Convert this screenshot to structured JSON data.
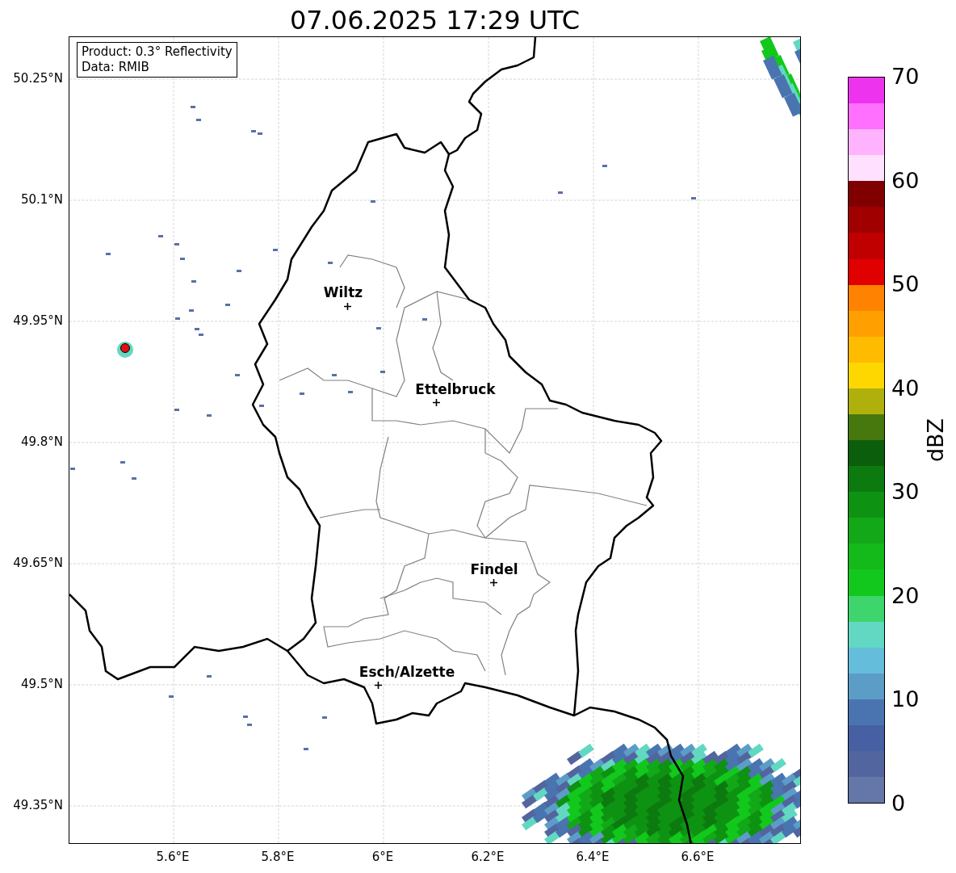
{
  "title": "07.06.2025 17:29 UTC",
  "map": {
    "legend": [
      "Product: 0.3° Reflectivity",
      "Data: RMIB"
    ],
    "lat_ticks": [
      "50.25°N",
      "50.1°N",
      "49.95°N",
      "49.8°N",
      "49.65°N",
      "49.5°N",
      "49.35°N"
    ],
    "lon_ticks": [
      "5.6°E",
      "5.8°E",
      "6°E",
      "6.2°E",
      "6.4°E",
      "6.6°E"
    ],
    "places": [
      {
        "name": "Wiltz"
      },
      {
        "name": "Ettelbruck"
      },
      {
        "name": "Findel"
      },
      {
        "name": "Esch/Alzette"
      }
    ]
  },
  "colorbar": {
    "label": "dBZ",
    "ticks": [
      "70",
      "60",
      "50",
      "40",
      "30",
      "20",
      "10",
      "0"
    ],
    "segments": [
      {
        "color": "#ee33ee"
      },
      {
        "color": "#ff70ff"
      },
      {
        "color": "#ffb3ff"
      },
      {
        "color": "#ffe0ff"
      },
      {
        "color": "#800000"
      },
      {
        "color": "#a00000"
      },
      {
        "color": "#c00000"
      },
      {
        "color": "#e00000"
      },
      {
        "color": "#ff8200"
      },
      {
        "color": "#ffa000"
      },
      {
        "color": "#ffbb00"
      },
      {
        "color": "#ffd700"
      },
      {
        "color": "#b0b00c"
      },
      {
        "color": "#46780e"
      },
      {
        "color": "#0b5e0b"
      },
      {
        "color": "#0c7a0f"
      },
      {
        "color": "#0e9212"
      },
      {
        "color": "#12a818"
      },
      {
        "color": "#13ba1a"
      },
      {
        "color": "#12c81c"
      },
      {
        "color": "#3ed66c"
      },
      {
        "color": "#62d8c2"
      },
      {
        "color": "#64bedb"
      },
      {
        "color": "#5c9dc8"
      },
      {
        "color": "#4a74b0"
      },
      {
        "color": "#4660a3"
      },
      {
        "color": "#53659e"
      },
      {
        "color": "#6577a8"
      }
    ]
  }
}
